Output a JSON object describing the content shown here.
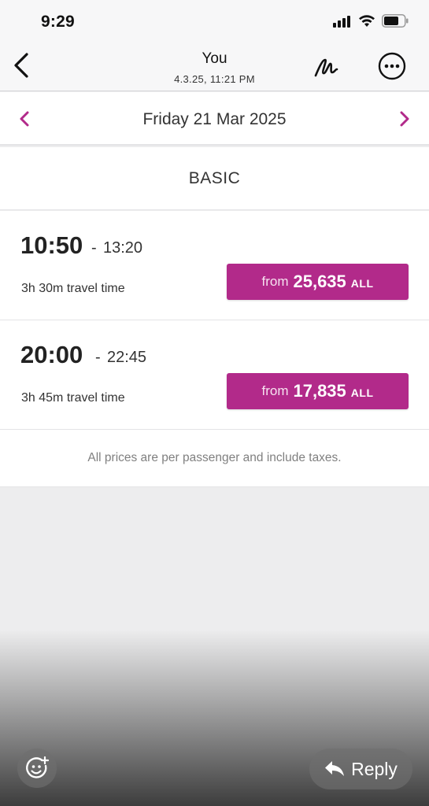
{
  "status_bar": {
    "time": "9:29",
    "icons": [
      "cellular-signal-icon",
      "wifi-icon",
      "battery-icon"
    ]
  },
  "header": {
    "sender": "You",
    "date": "4.3.25, 11:21 PM",
    "icons": [
      "back-chevron-icon",
      "markup-pen-icon",
      "more-options-icon"
    ]
  },
  "date_nav": {
    "label": "Friday 21 Mar 2025",
    "icons": [
      "previous-day-chevron-icon",
      "next-day-chevron-icon"
    ]
  },
  "fare": {
    "title": "BASIC"
  },
  "flights": [
    {
      "departure": "10:50",
      "separator": "-",
      "arrival": "13:20",
      "travel_time": "3h 30m travel time",
      "price_prefix": "from",
      "price": "25,635",
      "currency": "ALL"
    },
    {
      "departure": "20:00",
      "separator": "-",
      "arrival": "22:45",
      "travel_time": "3h 45m travel time",
      "price_prefix": "from",
      "price": "17,835",
      "currency": "ALL"
    }
  ],
  "disclaimer": "All prices are per passenger and include taxes.",
  "footer": {
    "reply_label": "Reply",
    "icons": [
      "sticker-add-icon",
      "reply-arrow-icon"
    ]
  },
  "colors": {
    "accent": "#b22a8a",
    "background": "#ededee"
  }
}
